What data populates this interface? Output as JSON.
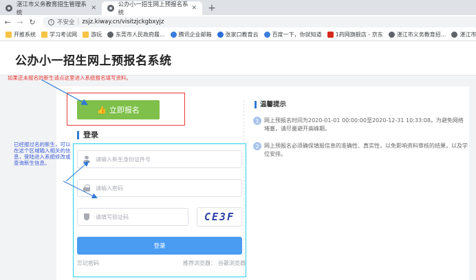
{
  "browser": {
    "tabs": [
      {
        "title": "湛江市义务教育招生管理系统",
        "active": false
      },
      {
        "title": "公办小一招生网上预报名系统",
        "active": true
      }
    ],
    "address": {
      "security": "不安全",
      "separator": "|",
      "url": "zsjz.kiway.cn/visitzjckgbxyjz"
    },
    "bookmarks": [
      {
        "label": "开推系统",
        "icon": "folder-icon"
      },
      {
        "label": "学习考试网",
        "icon": "folder-icon"
      },
      {
        "label": "游玩",
        "icon": "folder-icon"
      },
      {
        "label": "东莞市人民政府履...",
        "icon": "globe-icon"
      },
      {
        "label": "腾讯企业邮箱",
        "icon": "mail-icon"
      },
      {
        "label": "张家口教育云",
        "icon": "cloud-icon"
      },
      {
        "label": "百度一下，你就知道",
        "icon": "paw-icon"
      },
      {
        "label": "1药网旗舰店 - 京东",
        "icon": "jd-icon"
      },
      {
        "label": "湛江市义务教育招...",
        "icon": "globe-icon"
      },
      {
        "label": "湛江市",
        "icon": "globe-icon"
      }
    ]
  },
  "page": {
    "site_title": "公办小一招生网上预报名系统",
    "annotation_top": "如果还未报名的新生请点这里进入系统报名填写资料。",
    "annotation_left": "已经报过名的新生，可以在这个区域输入相关的信息，登陆进入系统修改或查询新生信息。",
    "register_button": "立即报名",
    "login": {
      "heading": "登录",
      "id_placeholder": "请输入新生身份证件号",
      "password_placeholder": "请输入密码",
      "captcha_placeholder": "请填写验证码",
      "captcha_text": "CE3F",
      "submit": "登录",
      "forgot": "忘记密码",
      "browser_hint": "推荐浏览器：",
      "browser_name": "谷歌浏览器"
    },
    "tips": {
      "heading": "温馨提示",
      "items": [
        {
          "num": "1",
          "text": "网上预报名时间为2020-01-01 00:00:00至2020-12-31 10:33:08。为避免网络堵塞，请尽量避开高峰期。"
        },
        {
          "num": "2",
          "text": "网上预报名必须确保填报信息的准确性、真实性，以免影响资料审核的结果，以及学位安排。"
        }
      ]
    },
    "colors": {
      "register_green": "#7ec04a",
      "login_blue": "#4a9cf3",
      "annotation_red": "#e53935",
      "annotation_cyan": "#1fd0e8",
      "annotation_blue": "#3a5ad8"
    }
  }
}
